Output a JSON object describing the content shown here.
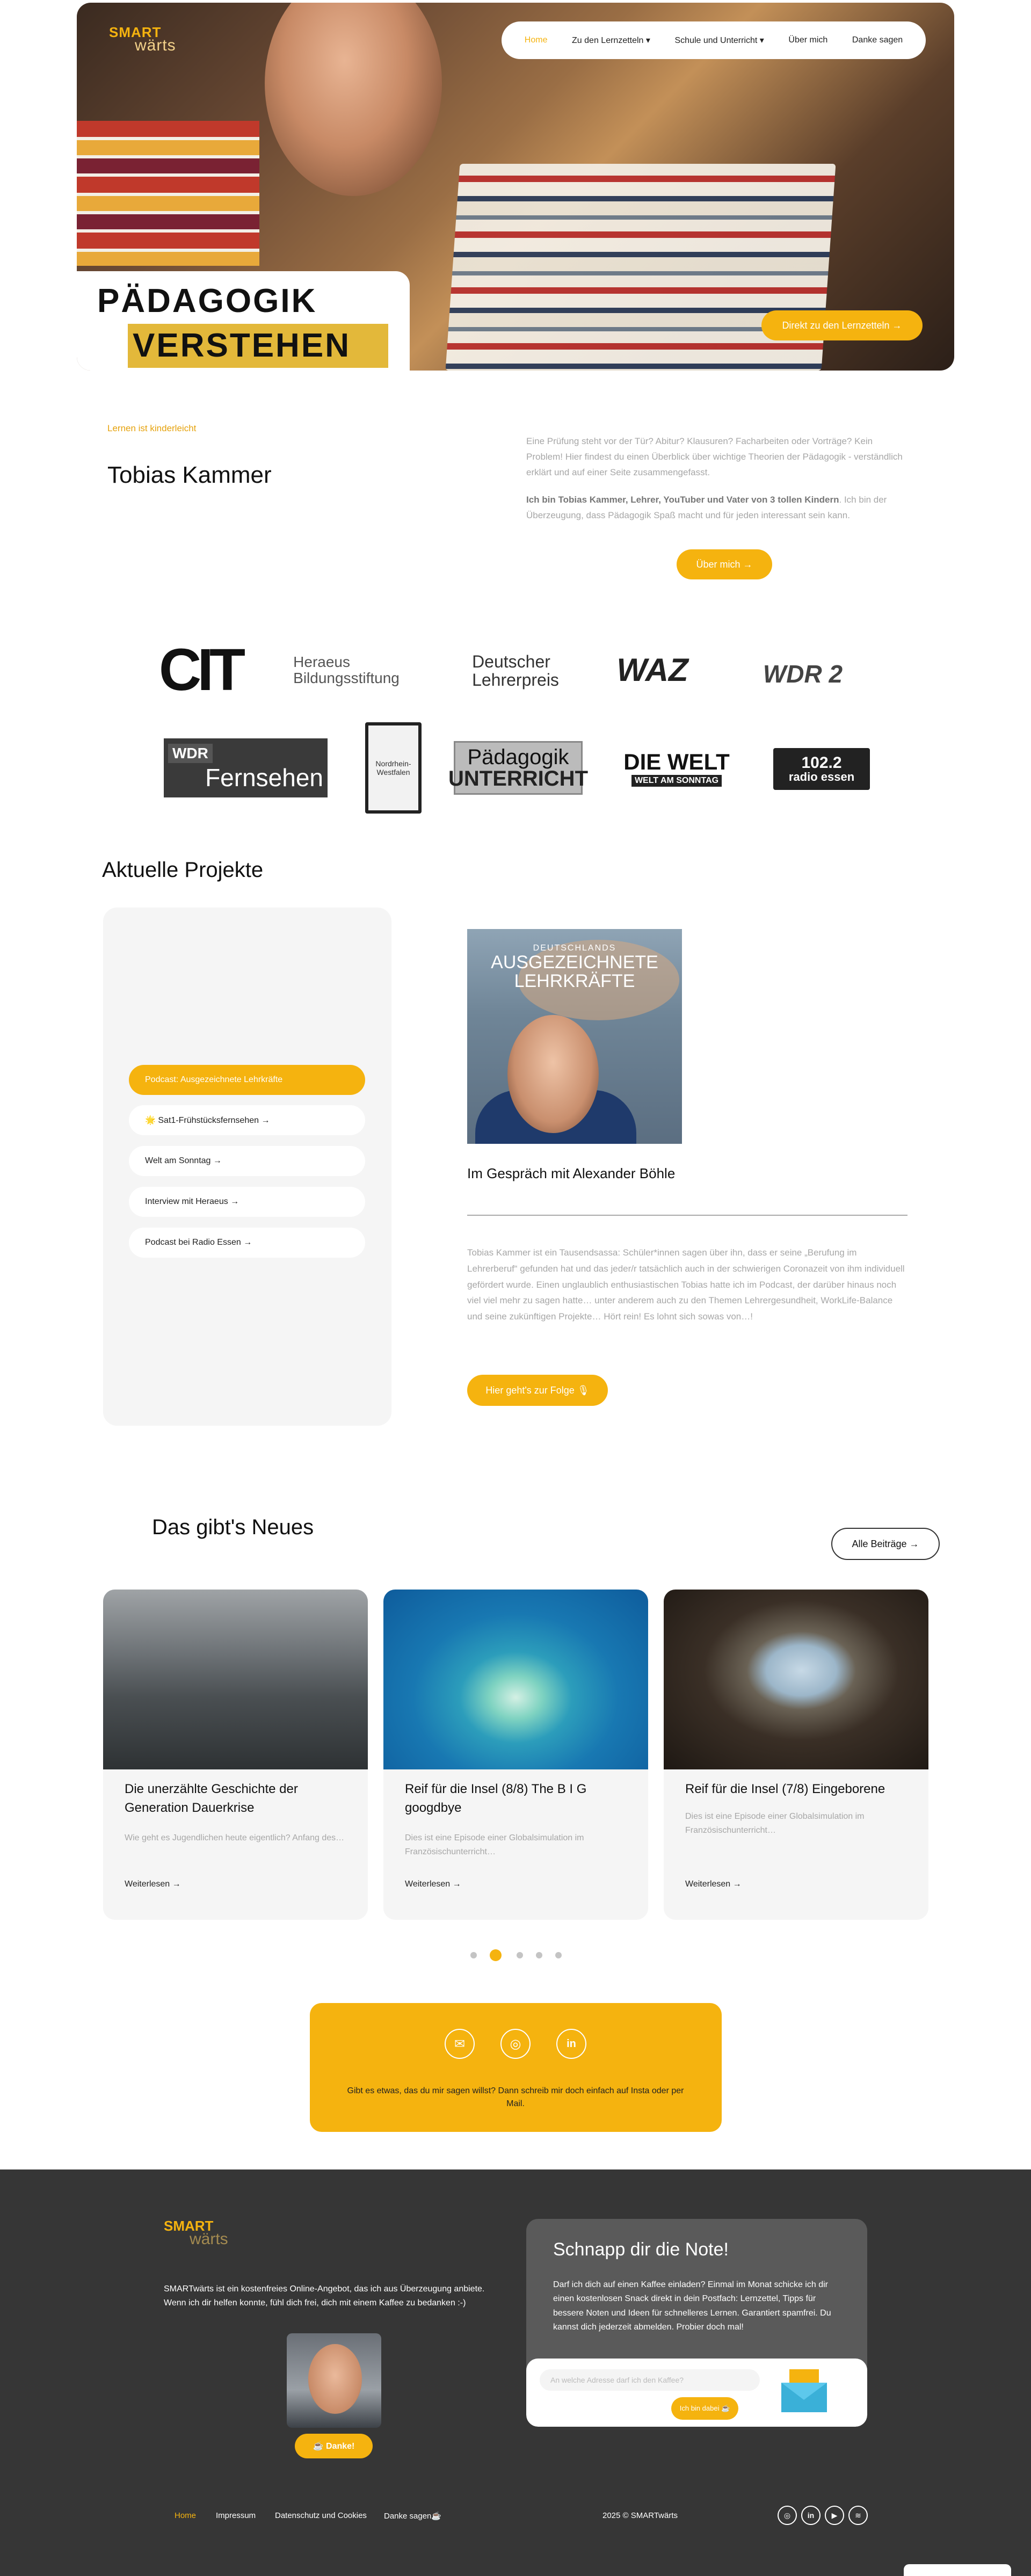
{
  "hero": {
    "logo_top": "SMART",
    "logo_bottom": "wärts",
    "nav": [
      "Home",
      "Zu den Lernzetteln ▾",
      "Schule und Unterricht ▾",
      "Über mich",
      "Danke sagen"
    ],
    "title_line1": "PÄDAGOGIK",
    "title_line2": "VERSTEHEN",
    "cta": "Direkt zu den Lernzetteln →"
  },
  "intro": {
    "eyebrow": "Lernen ist kinderleicht",
    "name": "Tobias Kammer",
    "text1": "Eine Prüfung steht vor der Tür? Abitur? Klausuren? Facharbeiten oder Vorträge? Kein Problem! Hier findest du einen Überblick über wichtige Theorien der Pädagogik - verständlich erklärt und auf einer Seite zusammengefasst.",
    "text2_bold": "Ich bin Tobias Kammer, Lehrer, YouTuber und Vater von 3 tollen Kindern",
    "text2_rest": ". Ich bin der Überzeugung, dass Pädagogik Spaß macht und für jeden interessant sein kann.",
    "button": "Über mich →"
  },
  "logos": {
    "cit": "CIT",
    "heraeus_1": "Heraeus",
    "heraeus_2": "Bildungsstiftung",
    "dl_1": "Deutscher",
    "dl_2": "Lehrerpreis",
    "waz": "WAZ",
    "wdr2": "WDR 2",
    "fern_1": "WDR",
    "fern_2": "Fernsehen",
    "nw": "Nordrhein-Westfalen",
    "pu_1": "Pädagogik",
    "pu_2": "UNTERRICHT",
    "welt_1": "DIE WELT",
    "welt_2": "WELT AM SONNTAG",
    "radio_1": "102.2",
    "radio_2": "radio essen"
  },
  "projects": {
    "title": "Aktuelle Projekte",
    "items": [
      "Podcast: Ausgezeichnete Lehrkräfte",
      "🌟 Sat1-Frühstücksfernsehen →",
      "Welt am Sonntag →",
      "Interview mit Heraeus →",
      "Podcast bei Radio Essen →"
    ],
    "img_small": "DEUTSCHLANDS",
    "img_big_1": "AUSGEZEICHNETE",
    "img_big_2": "LEHRKRÄFTE",
    "subtitle": "Im Gespräch mit Alexander Böhle",
    "text": "Tobias Kammer ist ein Tausendsassa: Schüler*innen sagen über ihn, dass er seine „Berufung im Lehrerberuf“ gefunden hat und das jeder/r tatsächlich auch in der schwierigen Coronazeit von ihm individuell gefördert wurde. Einen unglaublich enthusiastischen Tobias hatte ich im Podcast, der darüber hinaus noch viel viel mehr zu sagen hatte… unter anderem auch zu den Themen Lehrergesundheit, WorkLife-Balance und seine zukünftigen Projekte… Hört rein! Es lohnt sich sowas von…!",
    "button": "Hier geht's zur Folge 🎙"
  },
  "news": {
    "title": "Das gibt's Neues",
    "all_button": "Alle Beiträge →",
    "cards": [
      {
        "title": "Die unerzählte Geschichte der Generation Dauerkrise",
        "text": "Wie geht es Jugendlichen heute eigentlich? Anfang des…",
        "more": "Weiterlesen →"
      },
      {
        "title": "Reif für die Insel (8/8) The B I G googdbye",
        "text": "Dies ist eine Episode einer Globalsimulation im Französischunterricht…",
        "more": "Weiterlesen →"
      },
      {
        "title": "Reif für die Insel (7/8) Eingeborene",
        "text": "Dies ist eine Episode einer Globalsimulation im Französischunterricht…",
        "more": "Weiterlesen →"
      }
    ]
  },
  "contact": {
    "text": "Gibt es etwas, das du mir sagen willst? Dann schreib mir doch einfach auf Insta oder per Mail."
  },
  "footer": {
    "logo_top": "SMART",
    "logo_bottom": "wärts",
    "text": "SMARTwärts ist ein kostenfreies Online-Angebot, das ich aus Überzeugung anbiete. Wenn ich dir helfen konnte, fühl dich frei, dich mit einem Kaffee zu bedanken :-)",
    "danke": "☕ Danke!",
    "card_title": "Schnapp dir die Note!",
    "card_text": "Darf ich dich auf einen Kaffee einladen? Einmal im Monat schicke ich dir einen kostenlosen Snack direkt in dein Postfach: Lernzettel, Tipps für bessere Noten und Ideen für schnelleres Lernen. Garantiert spamfrei. Du kannst dich jederzeit abmelden. Probier doch mal!",
    "input_placeholder": "An welche Adresse darf ich den Kaffee?",
    "submit": "Ich bin dabei ☕",
    "links": [
      "Home",
      "Impressum",
      "Datenschutz und Cookies",
      "Danke sagen☕"
    ],
    "copyright": "2025 © SMARTwärts"
  },
  "colors": {
    "accent": "#f5b30f",
    "footer_bg": "#363636"
  }
}
